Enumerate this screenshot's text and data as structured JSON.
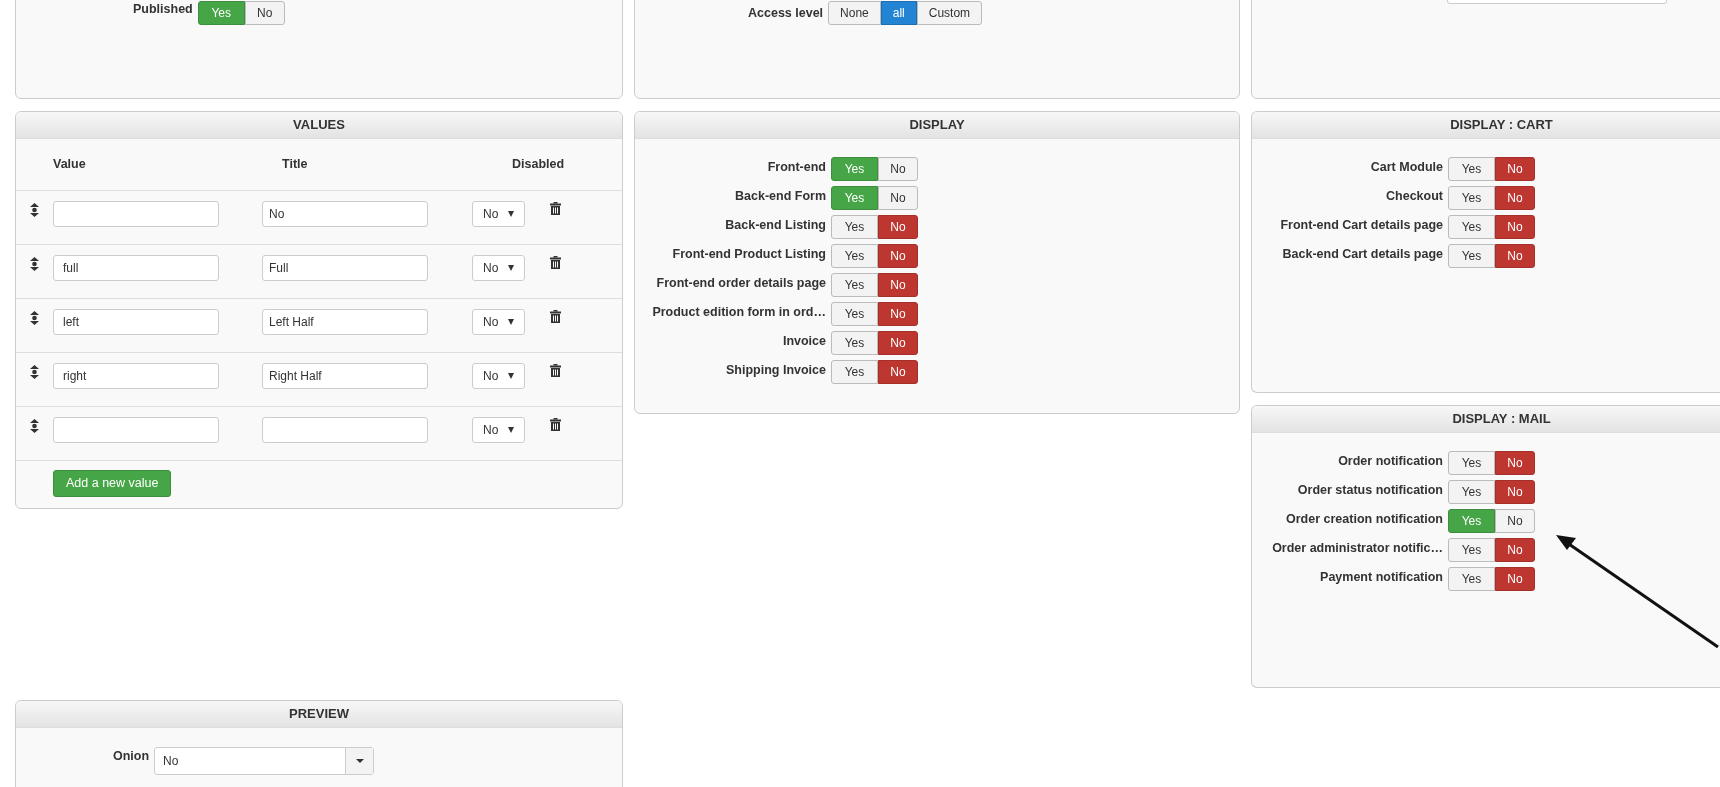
{
  "top_panels": {
    "published": {
      "label": "Published",
      "options": [
        {
          "label": "Yes",
          "selected": true
        },
        {
          "label": "No",
          "selected": false
        }
      ]
    },
    "access_level": {
      "label": "Access level",
      "options": [
        {
          "label": "None",
          "selected": false
        },
        {
          "label": "all",
          "selected": true
        },
        {
          "label": "Custom",
          "selected": false
        }
      ]
    }
  },
  "values": {
    "title": "VALUES",
    "columns": [
      "Value",
      "Title",
      "Disabled"
    ],
    "rows": [
      {
        "title": "No",
        "disabled": "No"
      },
      {
        "value": "full",
        "title": "Full",
        "disabled": "No"
      },
      {
        "value": "left",
        "title": "Left Half",
        "disabled": "No"
      },
      {
        "value": "right",
        "title": "Right Half",
        "disabled": "No"
      },
      {
        "disabled": "No"
      }
    ],
    "add_button": "Add a new value"
  },
  "display": {
    "title": "DISPLAY",
    "settings": [
      {
        "label": "Front-end",
        "options": [
          {
            "label": "Yes",
            "selected": true
          },
          {
            "label": "No",
            "selected": false
          }
        ]
      },
      {
        "label": "Back-end Form",
        "options": [
          {
            "label": "Yes",
            "selected": true
          },
          {
            "label": "No",
            "selected": false
          }
        ]
      },
      {
        "label": "Back-end Listing",
        "options": [
          {
            "label": "Yes",
            "selected": false
          },
          {
            "label": "No",
            "selected": true
          }
        ]
      },
      {
        "label": "Front-end Product Listing",
        "options": [
          {
            "label": "Yes",
            "selected": false
          },
          {
            "label": "No",
            "selected": true
          }
        ]
      },
      {
        "label": "Front-end order details page",
        "options": [
          {
            "label": "Yes",
            "selected": false
          },
          {
            "label": "No",
            "selected": true
          }
        ]
      },
      {
        "label": "Product edition form in ord…",
        "options": [
          {
            "label": "Yes",
            "selected": false
          },
          {
            "label": "No",
            "selected": true
          }
        ]
      },
      {
        "label": "Invoice",
        "options": [
          {
            "label": "Yes",
            "selected": false
          },
          {
            "label": "No",
            "selected": true
          }
        ]
      },
      {
        "label": "Shipping Invoice",
        "options": [
          {
            "label": "Yes",
            "selected": false
          },
          {
            "label": "No",
            "selected": true
          }
        ]
      }
    ]
  },
  "display_cart": {
    "title": "DISPLAY : CART",
    "settings": [
      {
        "label": "Cart Module",
        "options": [
          {
            "label": "Yes",
            "selected": false
          },
          {
            "label": "No",
            "selected": true
          }
        ]
      },
      {
        "label": "Checkout",
        "options": [
          {
            "label": "Yes",
            "selected": false
          },
          {
            "label": "No",
            "selected": true
          }
        ]
      },
      {
        "label": "Front-end Cart details page",
        "options": [
          {
            "label": "Yes",
            "selected": false
          },
          {
            "label": "No",
            "selected": true
          }
        ]
      },
      {
        "label": "Back-end Cart details page",
        "options": [
          {
            "label": "Yes",
            "selected": false
          },
          {
            "label": "No",
            "selected": true
          }
        ]
      }
    ]
  },
  "display_mail": {
    "title": "DISPLAY : MAIL",
    "settings": [
      {
        "label": "Order notification",
        "options": [
          {
            "label": "Yes",
            "selected": false
          },
          {
            "label": "No",
            "selected": true
          }
        ]
      },
      {
        "label": "Order status notification",
        "options": [
          {
            "label": "Yes",
            "selected": false
          },
          {
            "label": "No",
            "selected": true
          }
        ]
      },
      {
        "label": "Order creation notification",
        "options": [
          {
            "label": "Yes",
            "selected": true
          },
          {
            "label": "No",
            "selected": false
          }
        ]
      },
      {
        "label": "Order administrator notific…",
        "options": [
          {
            "label": "Yes",
            "selected": false
          },
          {
            "label": "No",
            "selected": true
          }
        ]
      },
      {
        "label": "Payment notification",
        "options": [
          {
            "label": "Yes",
            "selected": false
          },
          {
            "label": "No",
            "selected": true
          }
        ]
      }
    ]
  },
  "preview": {
    "title": "PREVIEW",
    "label": "Onion",
    "value": "No"
  }
}
